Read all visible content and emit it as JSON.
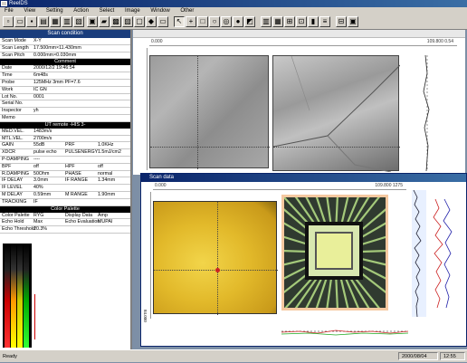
{
  "window": {
    "title": "ReelDS"
  },
  "menu": [
    "File",
    "View",
    "Setting",
    "Action",
    "Select",
    "Image",
    "Window",
    "Other"
  ],
  "leftpanel": {
    "title": "Scan condition",
    "scan_condition": [
      {
        "k": "Scan Mode",
        "v": "X-Y"
      },
      {
        "k": "Scan Length",
        "v": "17.500mm×11.430mm"
      },
      {
        "k": "Scan Pitch",
        "v": "0.000mm×0.030mm"
      }
    ],
    "comment_header": "Comment",
    "comment": [
      {
        "k": "Date",
        "v": "2000/12/2 19:46:54"
      },
      {
        "k": "Time",
        "v": "6m48s"
      },
      {
        "k": "Probe",
        "v": "125MHz 3mm PF=7.6"
      },
      {
        "k": "Work",
        "v": "IC GN"
      },
      {
        "k": "Lot No.",
        "v": "0001"
      },
      {
        "k": "Serial No.",
        "v": ""
      },
      {
        "k": "Inspector",
        "v": "yh"
      },
      {
        "k": "Memo",
        "v": ""
      }
    ],
    "ut_header": "UT remote -HIS 3-",
    "ut_single": [
      {
        "k": "MED.VEL.",
        "v": "1483m/s"
      },
      {
        "k": "MTL.VEL.",
        "v": "2700m/s"
      }
    ],
    "ut_quad": [
      {
        "a": "GAIN",
        "b": "55dB",
        "c": "PRF",
        "d": "1.0KHz"
      },
      {
        "a": "XDCR",
        "b": "pulse echo",
        "c": "PULSENERGY",
        "d": "1.5mJ/cm2"
      },
      {
        "a": "P-DAMPING",
        "b": "----",
        "c": "",
        "d": ""
      },
      {
        "a": "BPF",
        "b": "off",
        "c": "HPF",
        "d": "off"
      },
      {
        "a": "R.DAMPING",
        "b": "50Ohm",
        "c": "PHASE",
        "d": "normal"
      },
      {
        "a": "IF DELAY",
        "b": "3.0mm",
        "c": "IF RANGE",
        "d": "1.34mm"
      },
      {
        "a": "IF LEVEL",
        "b": "40%",
        "c": "",
        "d": ""
      },
      {
        "a": "M DELAY",
        "b": "0.59mm",
        "c": "M RANGE",
        "d": "1.90mm"
      },
      {
        "a": "TRACKING",
        "b": "IF",
        "c": "",
        "d": ""
      }
    ],
    "palette_header": "Color Palette",
    "palette_rows": [
      {
        "a": "Color Palette",
        "b": "RYG",
        "c": "Display Data",
        "d": "Amp"
      },
      {
        "a": "Echo Hold",
        "b": "Max",
        "c": "Echo Evaluation",
        "d": "MUPAI"
      },
      {
        "a": "Echo Threshold",
        "b": "20.3%",
        "c": "",
        "d": ""
      }
    ]
  },
  "image_window": {
    "coord_left": "0.000",
    "coord_right": "109.800 0.54"
  },
  "scan_window": {
    "title": "Scan data",
    "coord_left": "0.000",
    "coord_right": "109.800 1275",
    "side_label": "84.000"
  },
  "status": {
    "text": "Ready",
    "date": "2000/08/04",
    "time": "12:55"
  },
  "colors": {
    "titlebar": "#0a246a",
    "panel_header": "#000000",
    "scan_yellow": "#e2b92a"
  }
}
